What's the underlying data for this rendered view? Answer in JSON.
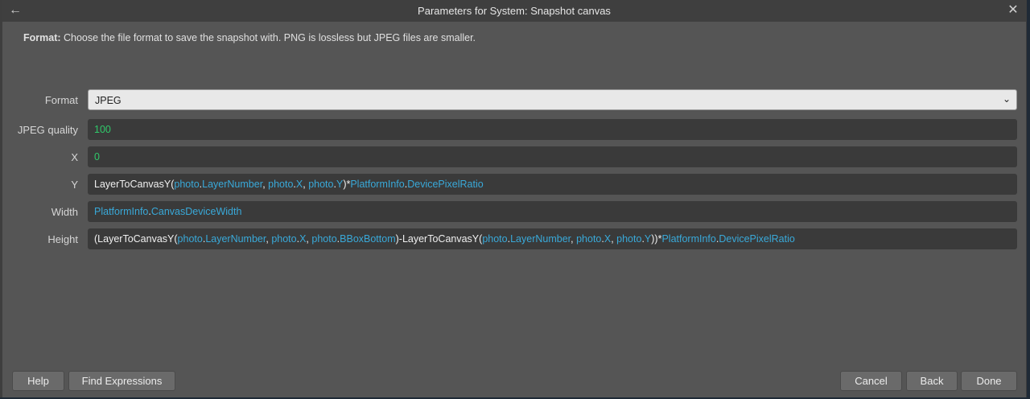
{
  "window": {
    "title": "Parameters for System: Snapshot canvas"
  },
  "description": {
    "label": "Format:",
    "text": " Choose the file format to save the snapshot with. PNG is lossless but JPEG files are smaller."
  },
  "params": {
    "format": {
      "label": "Format",
      "value": "JPEG"
    },
    "quality": {
      "label": "JPEG quality",
      "value": "100"
    },
    "x": {
      "label": "X",
      "value": "0"
    },
    "y": {
      "label": "Y"
    },
    "width": {
      "label": "Width"
    },
    "height": {
      "label": "Height"
    }
  },
  "expr": {
    "y": [
      {
        "t": "LayerToCanvasY",
        "c": "fn"
      },
      {
        "t": "(",
        "c": "p"
      },
      {
        "t": "photo",
        "c": "obj"
      },
      {
        "t": ".",
        "c": "p"
      },
      {
        "t": "LayerNumber",
        "c": "obj"
      },
      {
        "t": ", ",
        "c": "p"
      },
      {
        "t": "photo",
        "c": "obj"
      },
      {
        "t": ".",
        "c": "p"
      },
      {
        "t": "X",
        "c": "obj"
      },
      {
        "t": ", ",
        "c": "p"
      },
      {
        "t": "photo",
        "c": "obj"
      },
      {
        "t": ".",
        "c": "p"
      },
      {
        "t": "Y",
        "c": "obj"
      },
      {
        "t": ")*",
        "c": "p"
      },
      {
        "t": "PlatformInfo",
        "c": "obj"
      },
      {
        "t": ".",
        "c": "p"
      },
      {
        "t": "DevicePixelRatio",
        "c": "obj"
      }
    ],
    "width": [
      {
        "t": "PlatformInfo",
        "c": "obj"
      },
      {
        "t": ".",
        "c": "p"
      },
      {
        "t": "CanvasDeviceWidth",
        "c": "obj"
      }
    ],
    "height": [
      {
        "t": "(",
        "c": "p"
      },
      {
        "t": "LayerToCanvasY",
        "c": "fn"
      },
      {
        "t": "(",
        "c": "p"
      },
      {
        "t": "photo",
        "c": "obj"
      },
      {
        "t": ".",
        "c": "p"
      },
      {
        "t": "LayerNumber",
        "c": "obj"
      },
      {
        "t": ", ",
        "c": "p"
      },
      {
        "t": "photo",
        "c": "obj"
      },
      {
        "t": ".",
        "c": "p"
      },
      {
        "t": "X",
        "c": "obj"
      },
      {
        "t": ", ",
        "c": "p"
      },
      {
        "t": "photo",
        "c": "obj"
      },
      {
        "t": ".",
        "c": "p"
      },
      {
        "t": "BBoxBottom",
        "c": "obj"
      },
      {
        "t": ")-",
        "c": "p"
      },
      {
        "t": "LayerToCanvasY",
        "c": "fn"
      },
      {
        "t": "(",
        "c": "p"
      },
      {
        "t": "photo",
        "c": "obj"
      },
      {
        "t": ".",
        "c": "p"
      },
      {
        "t": "LayerNumber",
        "c": "obj"
      },
      {
        "t": ", ",
        "c": "p"
      },
      {
        "t": "photo",
        "c": "obj"
      },
      {
        "t": ".",
        "c": "p"
      },
      {
        "t": "X",
        "c": "obj"
      },
      {
        "t": ", ",
        "c": "p"
      },
      {
        "t": "photo",
        "c": "obj"
      },
      {
        "t": ".",
        "c": "p"
      },
      {
        "t": "Y",
        "c": "obj"
      },
      {
        "t": "))*",
        "c": "p"
      },
      {
        "t": "PlatformInfo",
        "c": "obj"
      },
      {
        "t": ".",
        "c": "p"
      },
      {
        "t": "DevicePixelRatio",
        "c": "obj"
      }
    ]
  },
  "buttons": {
    "help": "Help",
    "find": "Find Expressions",
    "cancel": "Cancel",
    "back": "Back",
    "done": "Done"
  },
  "icons": {
    "back": "back-arrow-icon",
    "close": "close-icon",
    "dropdown": "chevron-down-icon"
  },
  "colors": {
    "dialog_bg": "#555555",
    "titlebar_bg": "#3f3f3f",
    "field_bg": "#3a3a3a",
    "number": "#30c96a",
    "object": "#39a9d9"
  }
}
